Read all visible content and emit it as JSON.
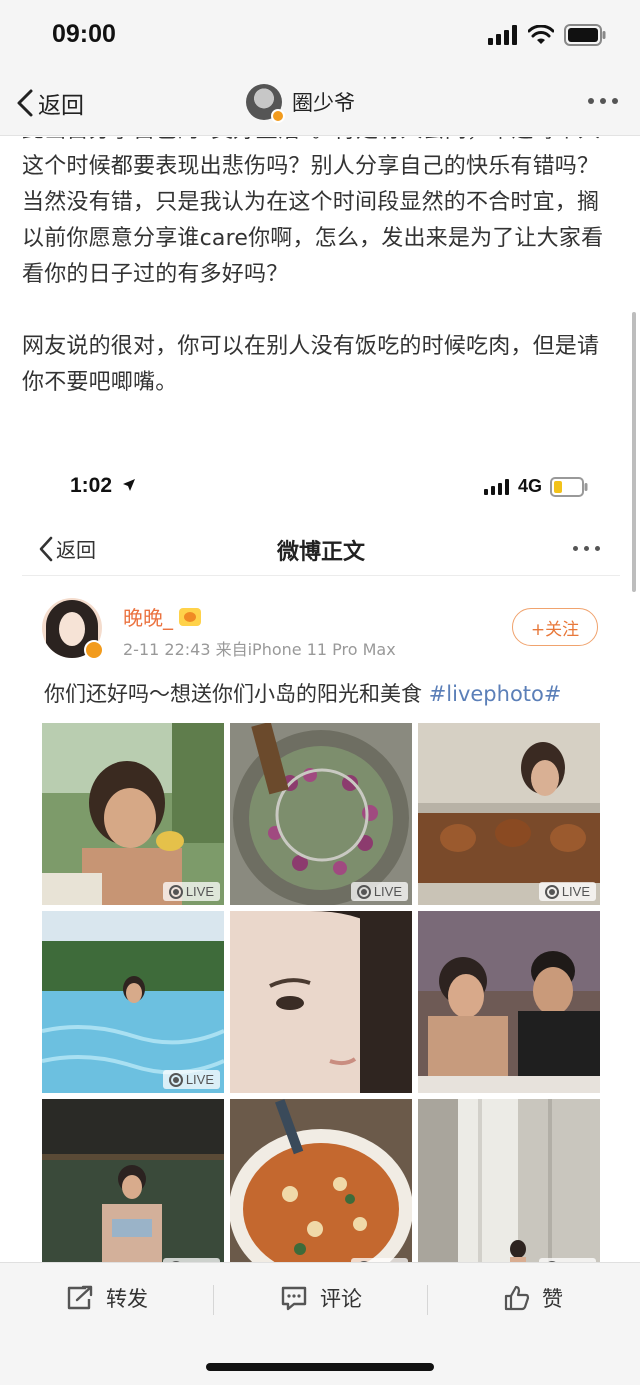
{
  "status_bar": {
    "time": "09:00"
  },
  "nav": {
    "back_label": "返回",
    "user_name": "圈少爷"
  },
  "article": {
    "paragraph_1": "此出自分享自己的“美好生活”。肯定有人会问，难道每个人这个时候都要表现出悲伤吗？别人分享自己的快乐有错吗？当然没有错，只是我认为在这个时间段显然的不合时宜，搁以前你愿意分享谁care你啊，怎么，发出来是为了让大家看看你的日子过的有多好吗？",
    "paragraph_2": "网友说的很对，你可以在别人没有饭吃的时候吃肉，但是请你不要吧唧嘴。"
  },
  "embedded": {
    "status_time": "1:02",
    "network": "4G",
    "back_label": "返回",
    "title": "微博正文",
    "post": {
      "author": "晚晚_",
      "meta": "2-11 22:43  来自iPhone 11 Pro Max",
      "follow_label": "+关注",
      "text": "你们还好吗～想送你们小岛的阳光和美食 ",
      "hashtag": "#livephoto#"
    },
    "live_label": "LIVE",
    "photos": [
      {
        "desc": "girl-eating-outdoor",
        "live": true
      },
      {
        "desc": "taro-balls-frying",
        "live": true
      },
      {
        "desc": "girl-at-bbq-stall",
        "live": true
      },
      {
        "desc": "girl-in-pool",
        "live": true
      },
      {
        "desc": "face-closeup",
        "live": false
      },
      {
        "desc": "couple-eating",
        "live": false
      },
      {
        "desc": "girl-under-pavilion",
        "live": true
      },
      {
        "desc": "tom-yum-soup",
        "live": true
      },
      {
        "desc": "girl-by-curtains",
        "live": true
      }
    ]
  },
  "bottom_bar": {
    "repost": "转发",
    "comment": "评论",
    "like": "赞"
  }
}
